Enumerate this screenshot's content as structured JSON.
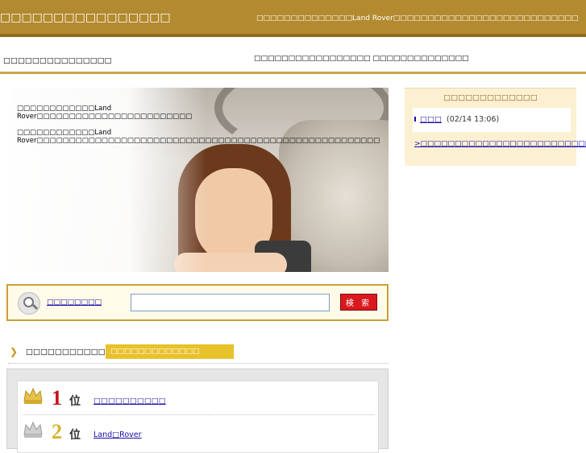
{
  "header": {
    "site_title": "□□□□□□□□□□□□□□□□",
    "tagline": "□□□□□□□□□□□□□□Land Rover□□□□□□□□□□□□□□□□□□□□□□□□□□□"
  },
  "subheader": {
    "left_text": "□□□□□□□□□□□□□□□",
    "right_text": "□□□□□□□□□□□□□□□□□ □□□□□□□□□□□□□□"
  },
  "hero": {
    "paragraph1": "□□□□□□□□□□□□Land Rover□□□□□□□□□□□□□□□□□□□□□□□□",
    "paragraph2": "□□□□□□□□□□□□Land Rover□□□□□□□□□□□□□□□□□□□□□□□□□□□□□□□□□□□□□□□□□□□□□□□□□□□□□"
  },
  "search": {
    "label": "□□□□□□□□",
    "input_value": "",
    "button_label": "検 索",
    "icon": "search-icon"
  },
  "ranking": {
    "title": "□□□□□□□□□□□□□",
    "tab_label": "□□□□□□□□□□□□□",
    "items": [
      {
        "rank": "1",
        "suffix": "位",
        "link": "□□□□□□□□□□",
        "icon": "crown-icon"
      },
      {
        "rank": "2",
        "suffix": "位",
        "link": "Land□Rover",
        "icon": "crown-icon"
      }
    ]
  },
  "sidebar": {
    "title": "□□□□□□□□□□□□□",
    "entry_link": "□□□",
    "entry_time": "(02/14 13:06)",
    "more_link": ">□□□□□□□□□□□□□□□□□□□□□□□□□"
  },
  "colors": {
    "header_bg": "#b38a2f",
    "accent_gold": "#e8c22b",
    "search_button": "#d9191e",
    "rank_red": "#c8101a"
  }
}
